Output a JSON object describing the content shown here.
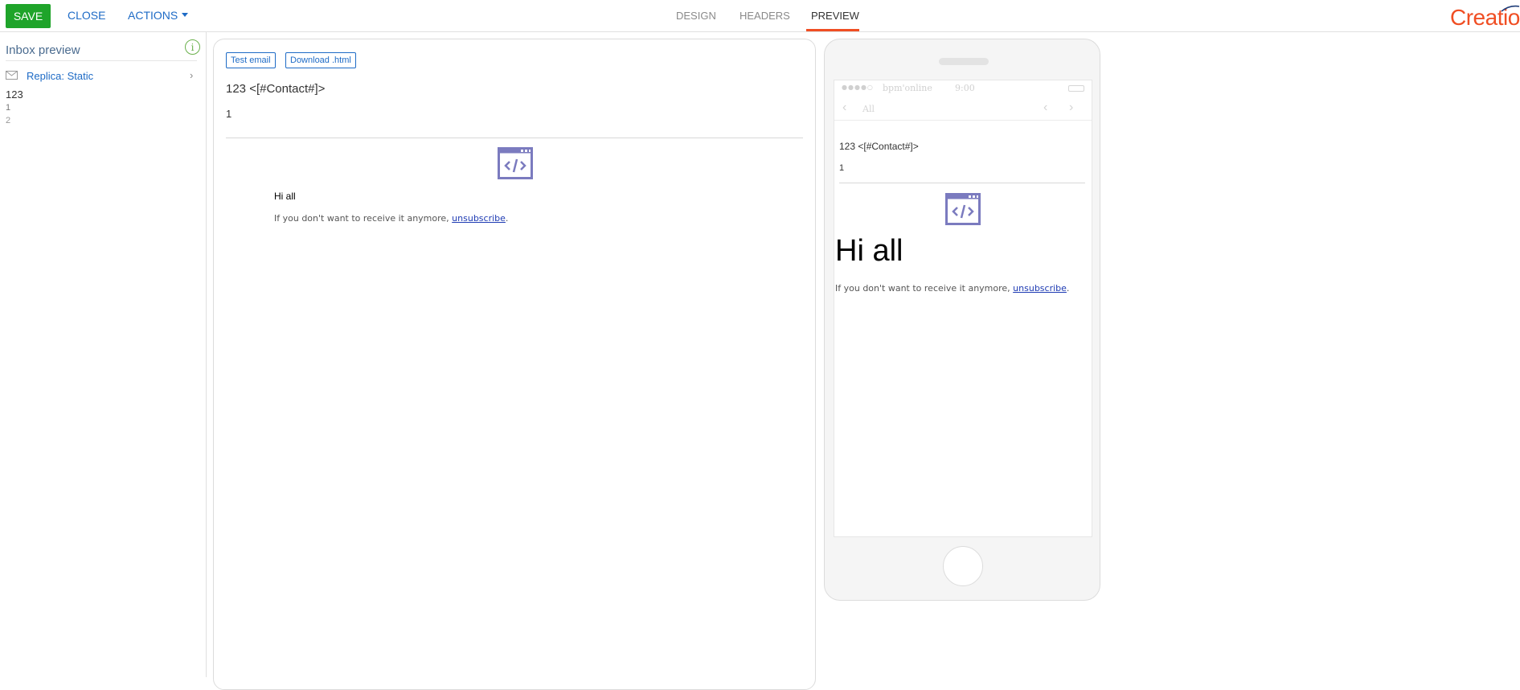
{
  "toolbar": {
    "save_label": "SAVE",
    "close_label": "CLOSE",
    "actions_label": "ACTIONS"
  },
  "tabs": [
    {
      "label": "DESIGN"
    },
    {
      "label": "HEADERS"
    },
    {
      "label": "PREVIEW",
      "active": true
    }
  ],
  "brand": {
    "logo_text": "Creatio",
    "accent_color": "#f04e23"
  },
  "sidebar": {
    "title": "Inbox preview",
    "info_glyph": "i",
    "item_label": "Replica: Static",
    "subject": "123",
    "lines": [
      "1",
      "2"
    ]
  },
  "desktop_preview": {
    "test_email_label": "Test email",
    "download_label": "Download .html",
    "subject": "123 <[#Contact#]>",
    "preheader": "1",
    "greeting": "Hi all",
    "unsubscribe_prefix": "If you don't want to receive it anymore, ",
    "unsubscribe_link": "unsubscribe",
    "unsubscribe_suffix": "."
  },
  "mobile_preview": {
    "carrier": "bpm'online",
    "time": "9:00",
    "nav_back_label": "All",
    "subject": "123 <[#Contact#]>",
    "preheader": "1",
    "greeting": "Hi all",
    "unsubscribe_prefix": "If you don't want to receive it anymore, ",
    "unsubscribe_link": "unsubscribe",
    "unsubscribe_suffix": "."
  },
  "colors": {
    "save_green": "#1fa42a",
    "link_blue": "#1e6bc6",
    "icon_purple": "#7b7bbf"
  }
}
